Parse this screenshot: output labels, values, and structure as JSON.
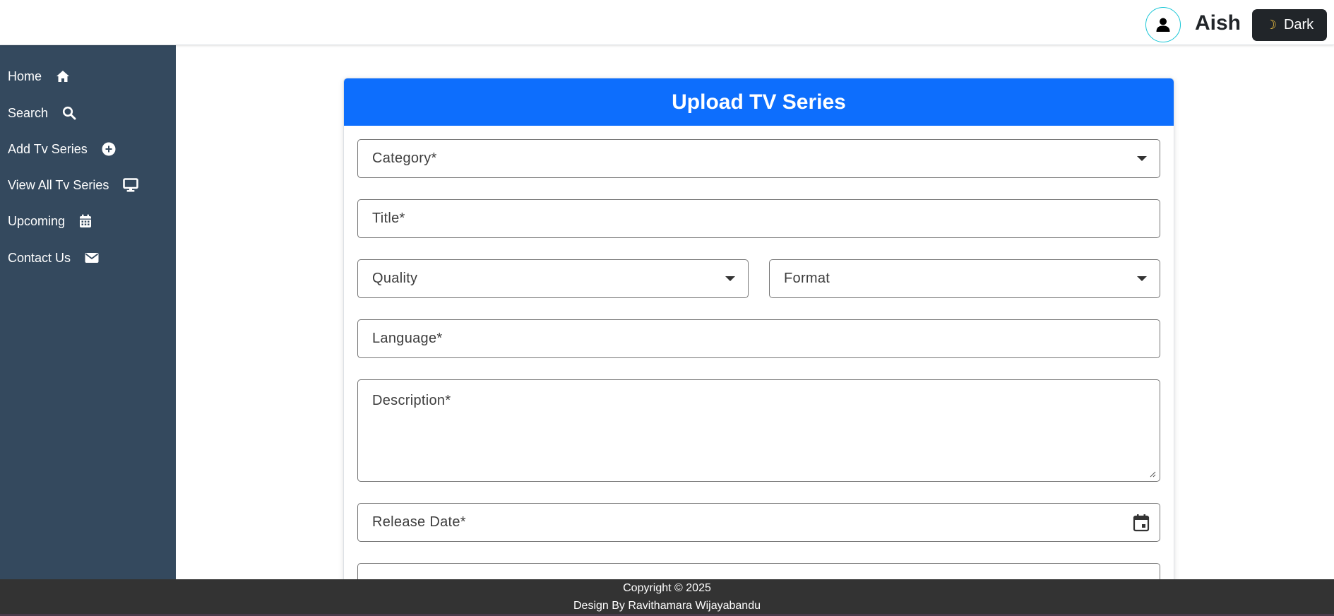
{
  "header": {
    "username": "Aish",
    "theme_toggle_label": "Dark",
    "icons": {
      "avatar": "user-icon",
      "theme": "moon-icon"
    }
  },
  "sidebar": {
    "items": [
      {
        "label": "Home",
        "icon": "home-icon"
      },
      {
        "label": "Search",
        "icon": "search-icon"
      },
      {
        "label": "Add Tv Series",
        "icon": "plus-circle-icon"
      },
      {
        "label": "View All Tv Series",
        "icon": "monitor-icon"
      },
      {
        "label": "Upcoming",
        "icon": "calendar-icon"
      },
      {
        "label": "Contact Us",
        "icon": "envelope-icon"
      }
    ]
  },
  "form": {
    "title": "Upload TV Series",
    "fields": {
      "category": {
        "placeholder": "Category*"
      },
      "title": {
        "placeholder": "Title*"
      },
      "quality": {
        "placeholder": "Quality"
      },
      "format": {
        "placeholder": "Format"
      },
      "language": {
        "placeholder": "Language*"
      },
      "description": {
        "placeholder": "Description*"
      },
      "release_date": {
        "placeholder": "Release Date*"
      }
    }
  },
  "footer": {
    "copyright": "Copyright © 2025",
    "credit": "Design By Ravithamara Wijayabandu"
  },
  "colors": {
    "sidebar_bg": "#34495e",
    "primary": "#0d6efd",
    "footer_bg": "#333333",
    "avatar_ring": "#19c6d6",
    "dark_button": "#212529"
  }
}
